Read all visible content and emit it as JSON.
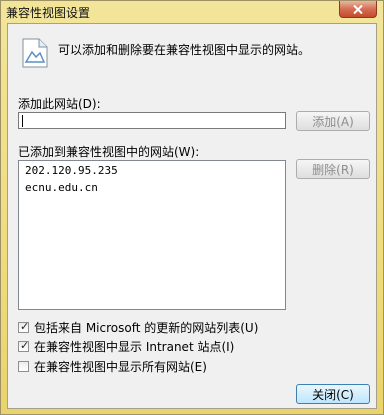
{
  "window": {
    "title": "兼容性视图设置"
  },
  "header": {
    "text": "可以添加和删除要在兼容性视图中显示的网站。"
  },
  "add_site": {
    "label": "添加此网站(D):",
    "value": "",
    "add_button": "添加(A)"
  },
  "site_list": {
    "label": "已添加到兼容性视图中的网站(W):",
    "items": [
      "202.120.95.235",
      "ecnu.edu.cn"
    ],
    "remove_button": "删除(R)"
  },
  "options": [
    {
      "label": "包括来自 Microsoft 的更新的网站列表(U)",
      "checked": true
    },
    {
      "label": "在兼容性视图中显示 Intranet 站点(I)",
      "checked": true
    },
    {
      "label": "在兼容性视图中显示所有网站(E)",
      "checked": false
    }
  ],
  "close_button": "关闭(C)",
  "colors": {
    "titlebar": "#eedc7e",
    "close": "#c54a2c",
    "focus_border": "#3c7fb1"
  }
}
